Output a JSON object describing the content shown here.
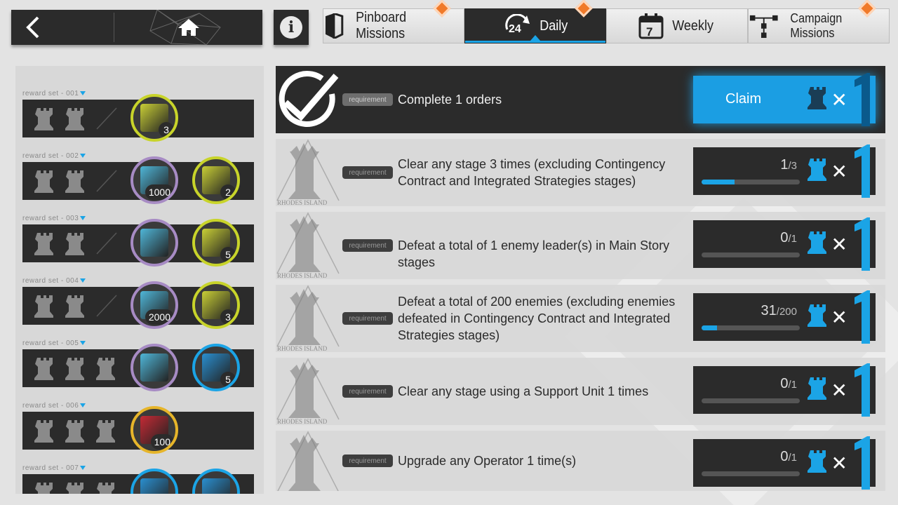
{
  "tabs": [
    {
      "label": "Pinboard Missions",
      "icon": "bookmark-icon",
      "active": false,
      "notif": true
    },
    {
      "label": "Daily",
      "icon": "24h-refresh-icon",
      "active": true,
      "notif": true
    },
    {
      "label": "Weekly",
      "icon": "calendar-7-icon",
      "active": false,
      "notif": false
    },
    {
      "label": "Campaign Missions",
      "icon": "network-icon",
      "active": false,
      "notif": true
    }
  ],
  "rewards": [
    {
      "label": "reward set - 001",
      "rooks": 2,
      "items": [
        {
          "count": "3",
          "ring": "yellow"
        }
      ]
    },
    {
      "label": "reward set - 002",
      "rooks": 2,
      "items": [
        {
          "count": "1000",
          "ring": "purple"
        },
        {
          "count": "2",
          "ring": "yellow"
        }
      ]
    },
    {
      "label": "reward set - 003",
      "rooks": 2,
      "items": [
        {
          "count": "",
          "ring": "purple"
        },
        {
          "count": "5",
          "ring": "yellow"
        }
      ]
    },
    {
      "label": "reward set - 004",
      "rooks": 2,
      "items": [
        {
          "count": "2000",
          "ring": "purple"
        },
        {
          "count": "3",
          "ring": "yellow"
        }
      ]
    },
    {
      "label": "reward set - 005",
      "rooks": 3,
      "items": [
        {
          "count": "",
          "ring": "purple"
        },
        {
          "count": "5",
          "ring": "blue"
        }
      ]
    },
    {
      "label": "reward set - 006",
      "rooks": 3,
      "items": [
        {
          "count": "100",
          "ring": "gold"
        }
      ]
    },
    {
      "label": "reward set - 007",
      "rooks": 3,
      "items": [
        {
          "count": "",
          "ring": "blue"
        },
        {
          "count": "",
          "ring": "blue"
        }
      ]
    }
  ],
  "missions": [
    {
      "requirement_tag": "requirement",
      "text": "Complete 1 orders",
      "claimable": true,
      "claim_label": "Claim",
      "progress": "",
      "total": "",
      "fill": 1.0,
      "reward_count": "1"
    },
    {
      "requirement_tag": "requirement",
      "text": "Clear any stage 3 times (excluding Contingency Contract and Integrated Strategies stages)",
      "claimable": false,
      "progress": "1",
      "total": "/3",
      "fill": 0.333,
      "reward_count": "1"
    },
    {
      "requirement_tag": "requirement",
      "text": "Defeat a total of 1 enemy leader(s) in Main Story stages",
      "claimable": false,
      "progress": "0",
      "total": "/1",
      "fill": 0,
      "reward_count": "1"
    },
    {
      "requirement_tag": "requirement",
      "text": "Defeat a total of 200 enemies (excluding enemies defeated in Contingency Contract and Integrated Strategies stages)",
      "claimable": false,
      "progress": "31",
      "total": "/200",
      "fill": 0.155,
      "reward_count": "1"
    },
    {
      "requirement_tag": "requirement",
      "text": "Clear any stage using a Support Unit 1 times",
      "claimable": false,
      "progress": "0",
      "total": "/1",
      "fill": 0,
      "reward_count": "1"
    },
    {
      "requirement_tag": "requirement",
      "text": "Upgrade any Operator 1 time(s)",
      "claimable": false,
      "progress": "0",
      "total": "/1",
      "fill": 0,
      "reward_count": "1"
    }
  ],
  "emblem_text": "RHODES ISLAND",
  "colors": {
    "accent": "#1ba4e6",
    "dark": "#2b2b2b",
    "notif": "#f07a2a"
  }
}
